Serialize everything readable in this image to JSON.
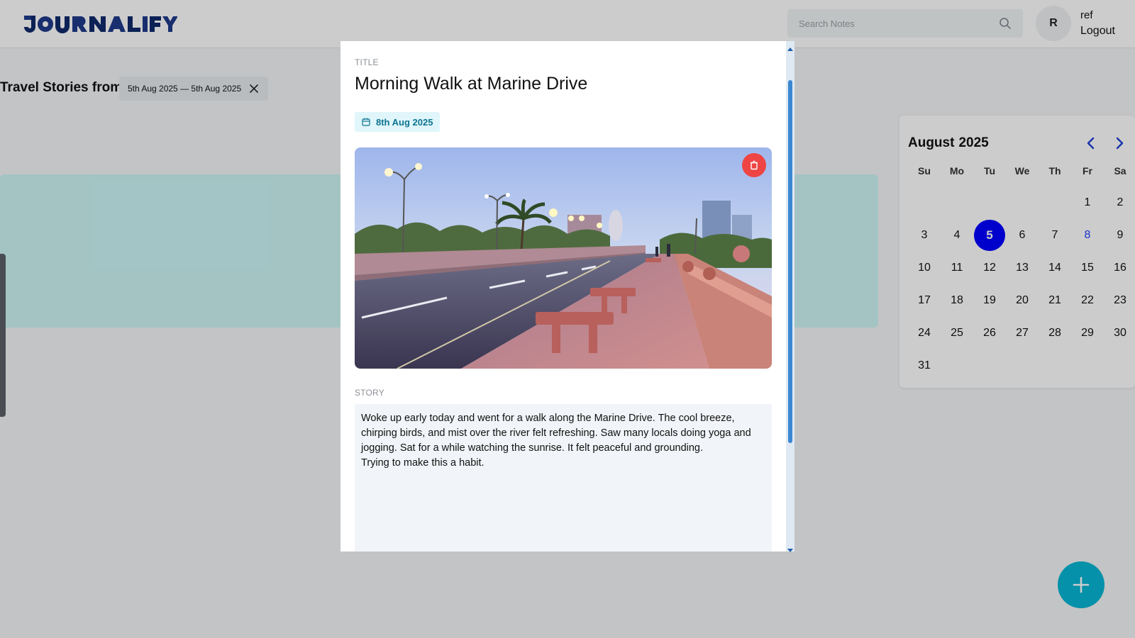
{
  "header": {
    "brand": "JOURNALIFY",
    "search_placeholder": "Search Notes",
    "avatar_initial": "R",
    "user_name": "ref",
    "logout_label": "Logout"
  },
  "filter": {
    "label": "Travel Stories from",
    "range": "5th Aug 2025 — 5th Aug 2025"
  },
  "calendar": {
    "month": "August",
    "year": "2025",
    "weekdays": [
      "Su",
      "Mo",
      "Tu",
      "We",
      "Th",
      "Fr",
      "Sa"
    ],
    "leading_blanks": 5,
    "days_in_month": 31,
    "selected_day": 5,
    "marked_days": [
      8
    ]
  },
  "modal": {
    "title_label": "TITLE",
    "title": "Morning Walk at Marine Drive",
    "date": "8th Aug 2025",
    "story_label": "STORY",
    "story": "Woke up early today and went for a walk along the Marine Drive. The cool breeze, chirping birds, and mist over the river felt refreshing. Saw many locals doing yoga and jogging. Sat for a while watching the sunrise. It felt peaceful and grounding.\nTrying to make this a habit."
  },
  "colors": {
    "accent": "#06b6d4",
    "selected_day": "#0000ff",
    "delete": "#ef4444",
    "card": "#cdf6f6"
  },
  "icons": {
    "search": "search-icon",
    "close": "close-icon",
    "calendar": "calendar-icon",
    "delete": "trash-icon",
    "prev": "chevron-left-icon",
    "next": "chevron-right-icon",
    "add": "plus-icon"
  }
}
